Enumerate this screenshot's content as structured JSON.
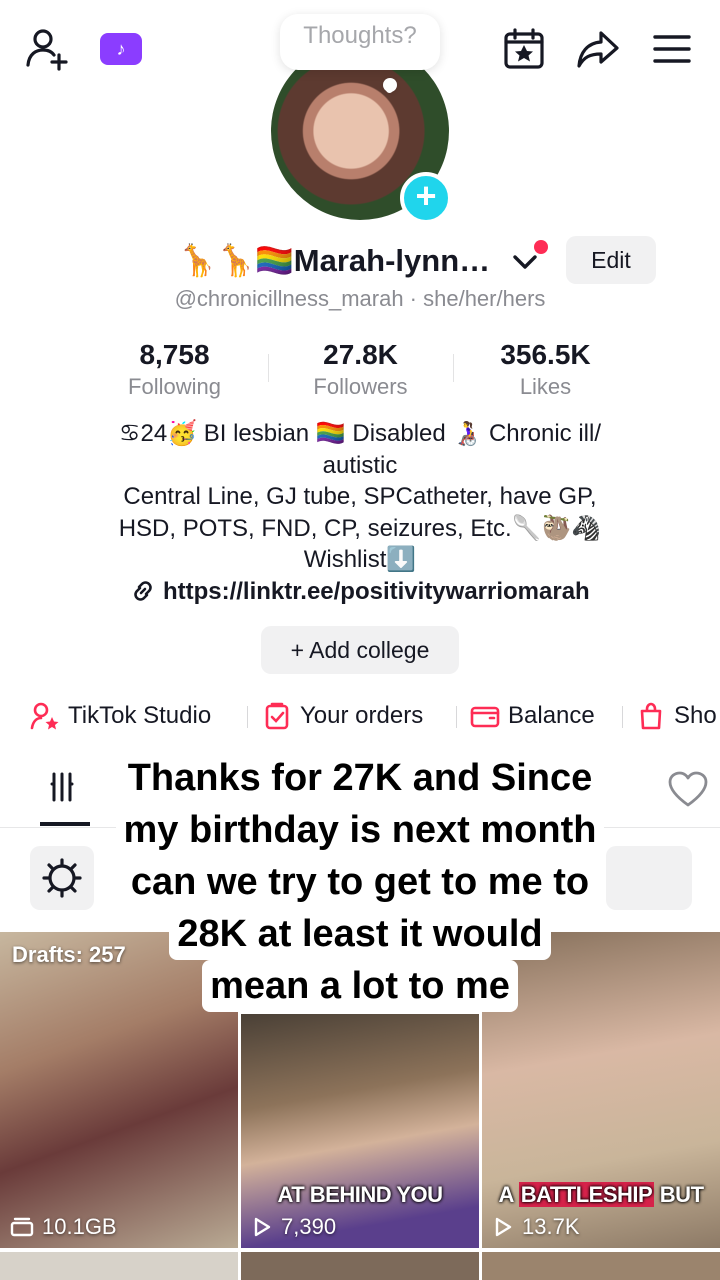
{
  "header": {
    "thought_bubble": "Thoughts?",
    "tiktok_badge_glyph": "♪"
  },
  "profile": {
    "display_name": "🦒🦒🏳️‍🌈Marah-lynn…",
    "edit_label": "Edit",
    "handle": "@chronicillness_marah · she/her/hers",
    "stats": [
      {
        "value": "8,758",
        "label": "Following"
      },
      {
        "value": "27.8K",
        "label": "Followers"
      },
      {
        "value": "356.5K",
        "label": "Likes"
      }
    ],
    "bio_lines": [
      "♋24🥳 BI lesbian 🏳️‍🌈 Disabled 👩‍🦽 Chronic ill/",
      "autistic",
      "Central Line, GJ tube, SPCatheter, have GP,",
      "HSD, POTS, FND, CP, seizures, Etc.🥄🦥🦓",
      "Wishlist⬇️"
    ],
    "link": "https://linktr.ee/positivitywarriomarah",
    "add_college_label": "+ Add college"
  },
  "tools": [
    {
      "label": "TikTok Studio"
    },
    {
      "label": "Your orders"
    },
    {
      "label": "Balance"
    },
    {
      "label": "Sho"
    }
  ],
  "overlay_lines": [
    "Thanks for 27K and Since",
    "my birthday is next month",
    "can we try to get to me to",
    "28K at least it would",
    "mean a lot to me"
  ],
  "videos": [
    {
      "drafts": "Drafts: 257",
      "meta": "10.1GB"
    },
    {
      "caption_a": "AT",
      "caption_b": "BEHIND YOU",
      "views": "7,390"
    },
    {
      "caption_a": "A",
      "caption_b": "BATTLESHIP",
      "caption_c": "BUT",
      "views": "13.7K"
    }
  ],
  "colors": {
    "accent": "#fe2c55",
    "avatar_plus": "#20d5ec",
    "studio_purple": "#8b3dff"
  }
}
